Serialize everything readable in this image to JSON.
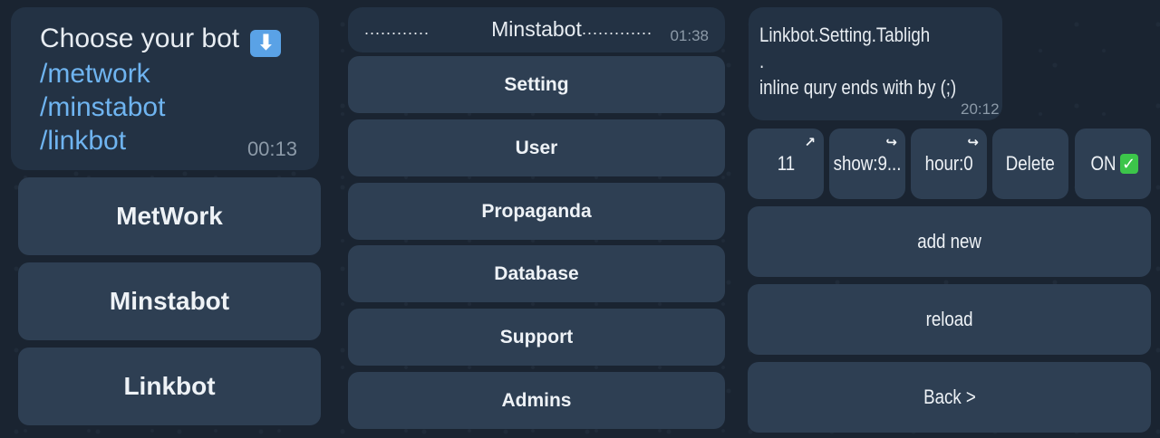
{
  "panel1": {
    "message": {
      "heading": "Choose your bot",
      "heading_emoji": "⬇",
      "commands": [
        "/metwork",
        "/minstabot",
        "/linkbot"
      ],
      "time": "00:13"
    },
    "buttons": [
      "MetWork",
      "Minstabot",
      "Linkbot"
    ]
  },
  "panel2": {
    "header": {
      "dots_left": "............",
      "title": "Minstabot",
      "dots_right": "..............",
      "time": "01:38"
    },
    "buttons": [
      "Setting",
      "User",
      "Propaganda",
      "Database",
      "Support",
      "Admins"
    ]
  },
  "panel3": {
    "message": {
      "lines": [
        "Linkbot.Setting.Tabligh",
        ".",
        "inline qury ends with by (;)"
      ],
      "time": "20:12"
    },
    "row": [
      {
        "label": "11",
        "arrow": "↗"
      },
      {
        "label": "show:9...",
        "arrow": "↪"
      },
      {
        "label": "hour:0",
        "arrow": "↪"
      },
      {
        "label": "Delete",
        "arrow": ""
      },
      {
        "label": "ON",
        "check": "✓"
      }
    ],
    "buttons": [
      "add new",
      "reload",
      "Back >"
    ]
  },
  "colors": {
    "bubble": "#233244",
    "button": "#2e3f53",
    "link": "#6fb4f0",
    "check": "#3cc54a"
  }
}
